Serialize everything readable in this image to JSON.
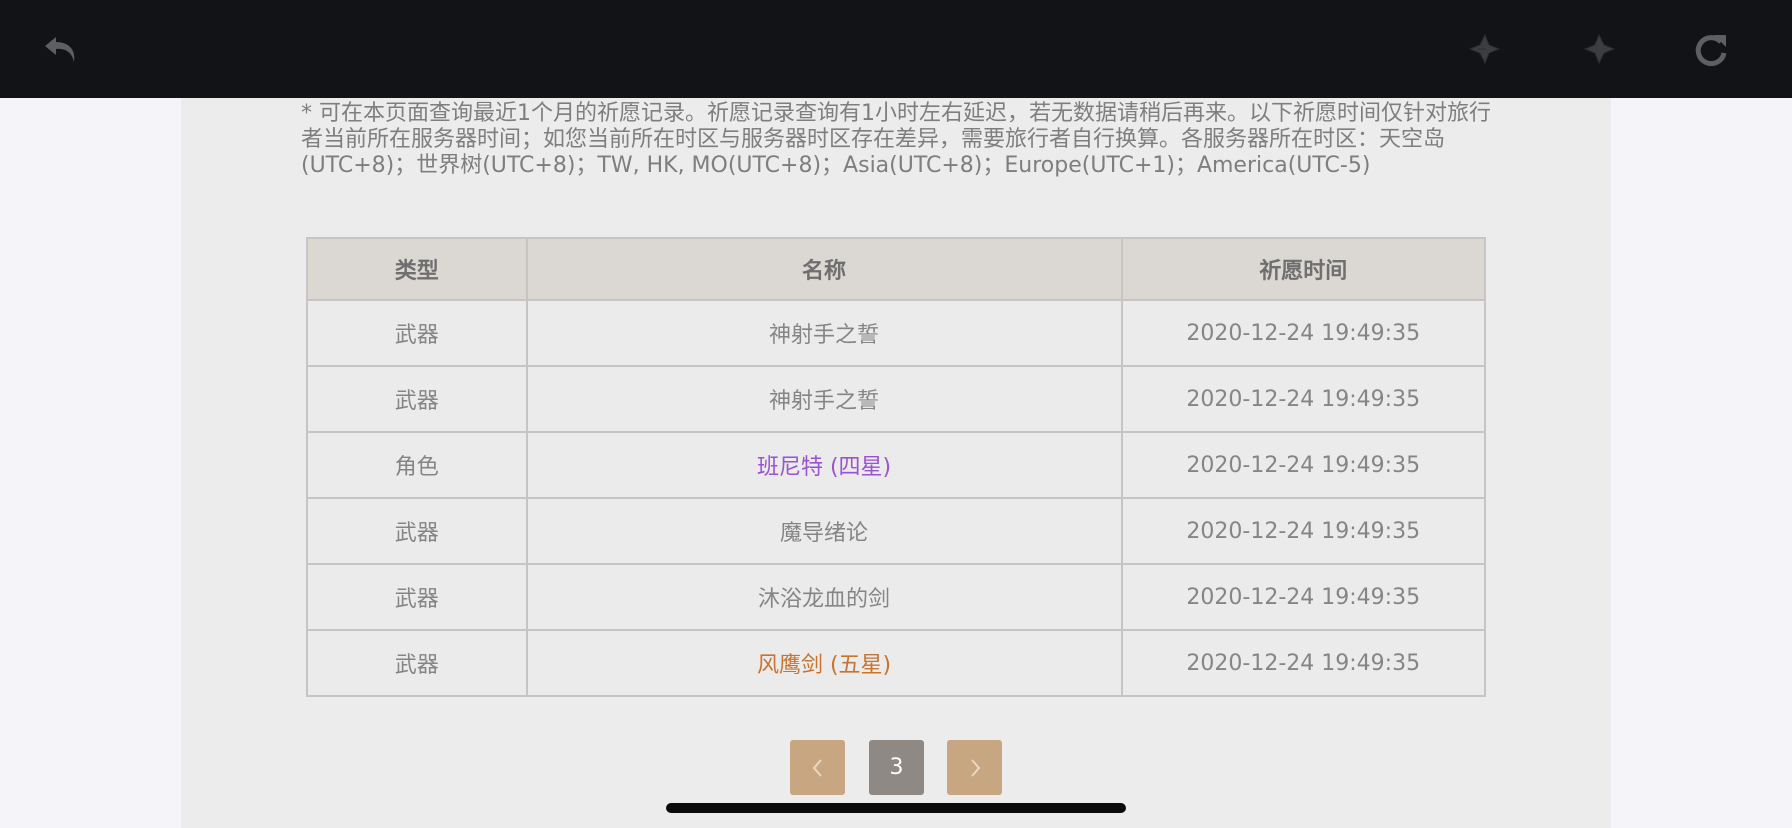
{
  "toolbar": {
    "back_icon": "undo-arrow-icon",
    "prev_icon": "sparkle-back-icon",
    "next_icon": "sparkle-forward-icon",
    "refresh_icon": "refresh-icon"
  },
  "notice": {
    "text": "* 可在本页面查询最近1个月的祈愿记录。祈愿记录查询有1小时左右延迟，若无数据请稍后再来。以下祈愿时间仅针对旅行者当前所在服务器时间；如您当前所在时区与服务器时区存在差异，需要旅行者自行换算。各服务器所在时区：天空岛(UTC+8)；世界树(UTC+8)；TW, HK, MO(UTC+8)；Asia(UTC+8)；Europe(UTC+1)；America(UTC-5)"
  },
  "table": {
    "headers": [
      "类型",
      "名称",
      "祈愿时间"
    ],
    "rows": [
      {
        "type": "武器",
        "name": "神射手之誓",
        "time": "2020-12-24 19:49:35",
        "color": "#858585"
      },
      {
        "type": "武器",
        "name": "神射手之誓",
        "time": "2020-12-24 19:49:35",
        "color": "#858585"
      },
      {
        "type": "角色",
        "name": "班尼特 (四星)",
        "time": "2020-12-24 19:49:35",
        "color": "#9a52d6"
      },
      {
        "type": "武器",
        "name": "魔导绪论",
        "time": "2020-12-24 19:49:35",
        "color": "#858585"
      },
      {
        "type": "武器",
        "name": "沐浴龙血的剑",
        "time": "2020-12-24 19:49:35",
        "color": "#858585"
      },
      {
        "type": "武器",
        "name": "风鹰剑 (五星)",
        "time": "2020-12-24 19:49:35",
        "color": "#c9732f"
      }
    ]
  },
  "pagination": {
    "prev_label": "‹",
    "current_page": "3",
    "next_label": "›"
  },
  "colors": {
    "topbar": "#121316",
    "panel": "#ececec",
    "header_bg": "#dbd7d3",
    "pager_arrow": "#c8a681",
    "pager_current": "#8f8985",
    "four_star": "#9a52d6",
    "five_star": "#c9732f"
  }
}
